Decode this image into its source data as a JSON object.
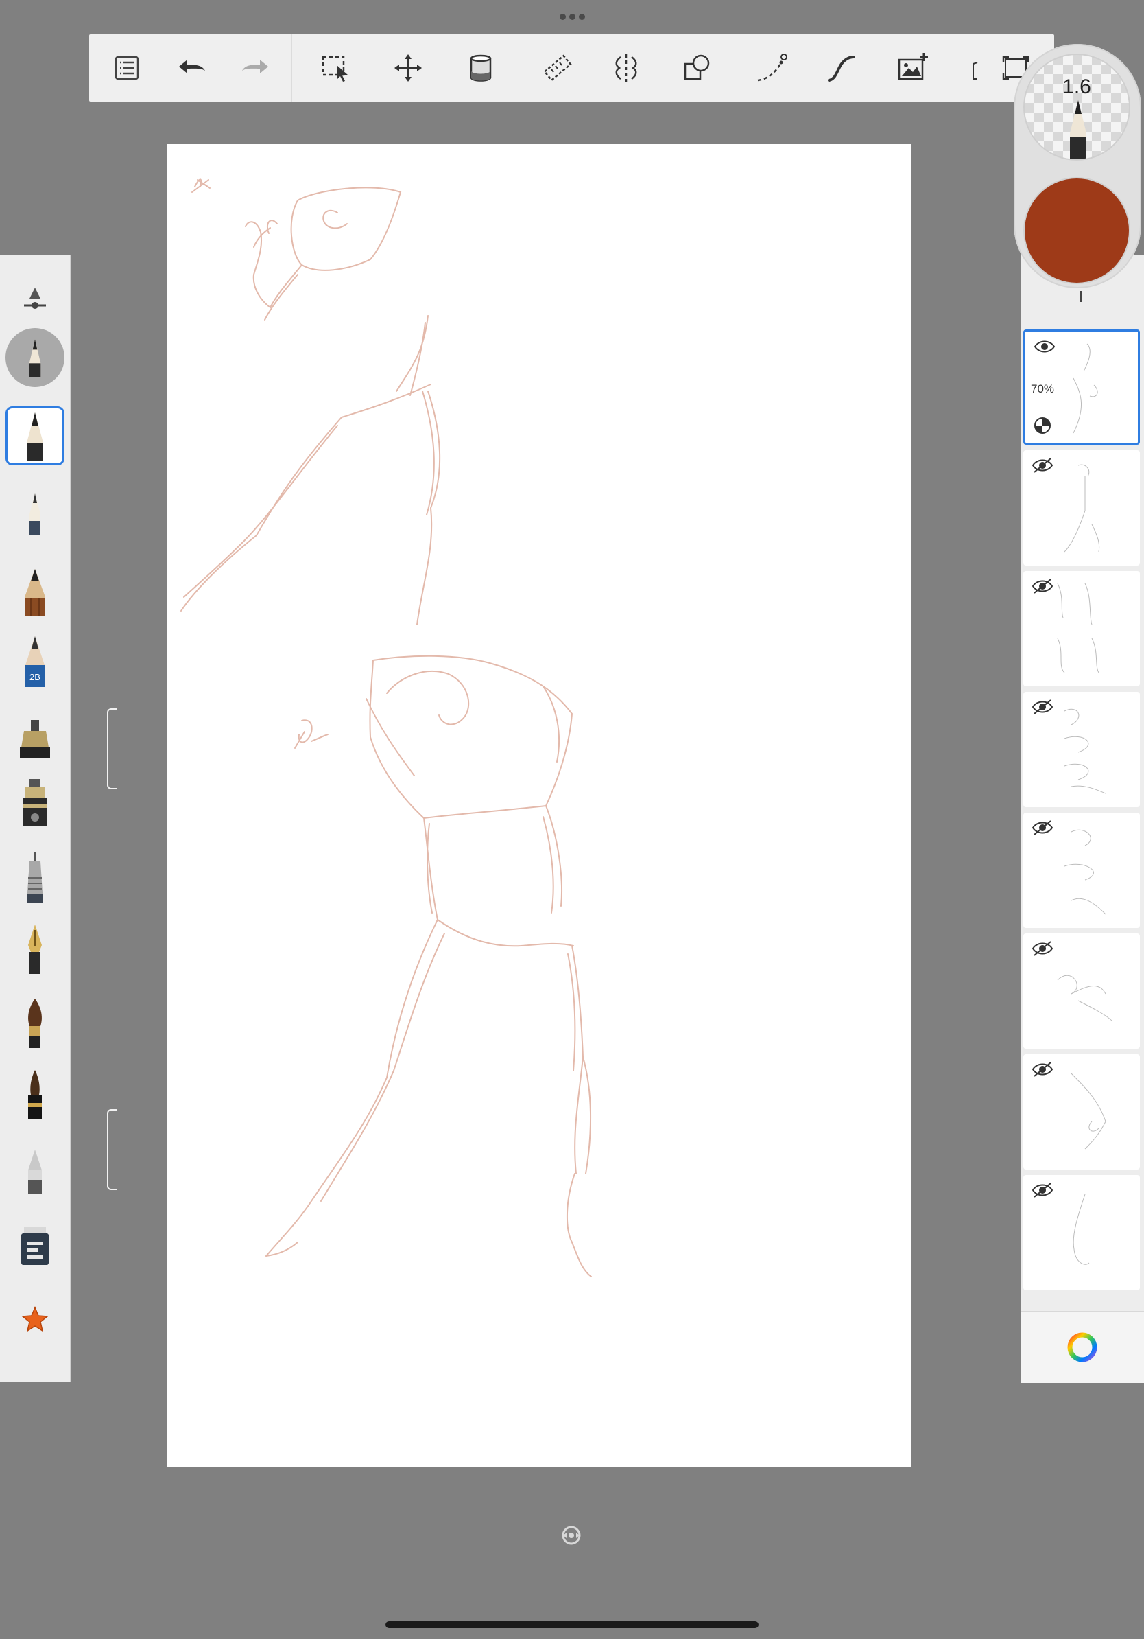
{
  "toolbar": {
    "items": [
      {
        "name": "layers-list-icon"
      },
      {
        "name": "undo-icon"
      },
      {
        "name": "redo-icon"
      },
      {
        "name": "selection-icon"
      },
      {
        "name": "transform-icon"
      },
      {
        "name": "fill-icon"
      },
      {
        "name": "ruler-icon"
      },
      {
        "name": "symmetry-icon"
      },
      {
        "name": "shape-icon"
      },
      {
        "name": "curve-icon"
      },
      {
        "name": "stroke-icon"
      },
      {
        "name": "add-image-icon"
      },
      {
        "name": "fullscreen-icon"
      }
    ]
  },
  "brush_puck": {
    "size": "1.6",
    "current_color": "#9e3a18"
  },
  "left_panel": {
    "brushes": [
      "brush-size-slider-icon",
      "current-brush-icon",
      "pencil-icon",
      "hard-pencil-icon",
      "wood-pencil-icon",
      "pencil-2b-icon",
      "marker-icon",
      "chisel-marker-icon",
      "technical-pen-icon",
      "fountain-pen-icon",
      "paintbrush-icon",
      "ink-brush-icon",
      "eraser-icon",
      "airbrush-icon",
      "favorites-star-icon"
    ],
    "pencil_label": "2B"
  },
  "layers": {
    "items": [
      {
        "visible": true,
        "opacity": "70%",
        "selected": true
      },
      {
        "visible": false
      },
      {
        "visible": false
      },
      {
        "visible": false
      },
      {
        "visible": false
      },
      {
        "visible": false
      },
      {
        "visible": false
      },
      {
        "visible": false
      }
    ]
  },
  "colors": {
    "accent": "#2f7de1",
    "sketch_stroke": "#e3b9ab",
    "background": "#808080"
  }
}
